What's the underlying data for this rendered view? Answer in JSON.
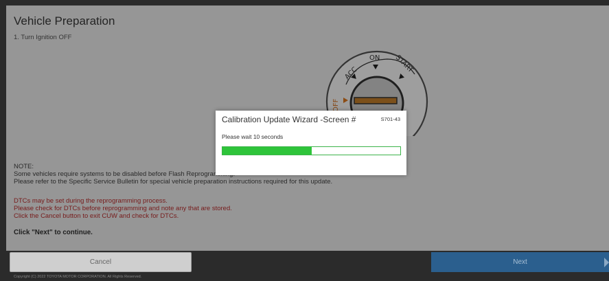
{
  "page": {
    "title": "Vehicle Preparation",
    "step": "1. Turn Ignition OFF",
    "note_lines": [
      "NOTE:",
      "Some vehicles require systems to be disabled before Flash Reprogramming.",
      "Please refer to the Specific Service Bulletin for special vehicle preparation instructions required for this update."
    ],
    "dtc_lines": [
      "DTCs may be set during the reprogramming process.",
      "Please check for DTCs before reprogramming and note any that are stored.",
      "Click the Cancel button to exit CUW and check for DTCs."
    ],
    "cta": "Click \"Next\" to continue."
  },
  "ignition": {
    "acc": "ACC",
    "on": "ON",
    "start": "START",
    "off": "OFF"
  },
  "buttons": {
    "cancel": "Cancel",
    "next": "Next"
  },
  "footer": {
    "copyright": "Copyright (C) 2022 TOYOTA MOTOR CORPORATION. All Rights Reserved."
  },
  "dialog": {
    "title": "Calibration Update Wizard -Screen #",
    "code": "S701-43",
    "message": "Please wait 10 seconds",
    "progress_fraction": 0.5
  },
  "colors": {
    "progress_fill": "#2ec43a",
    "dtc_text": "#c03030",
    "next_button": "#2b5f8e"
  }
}
